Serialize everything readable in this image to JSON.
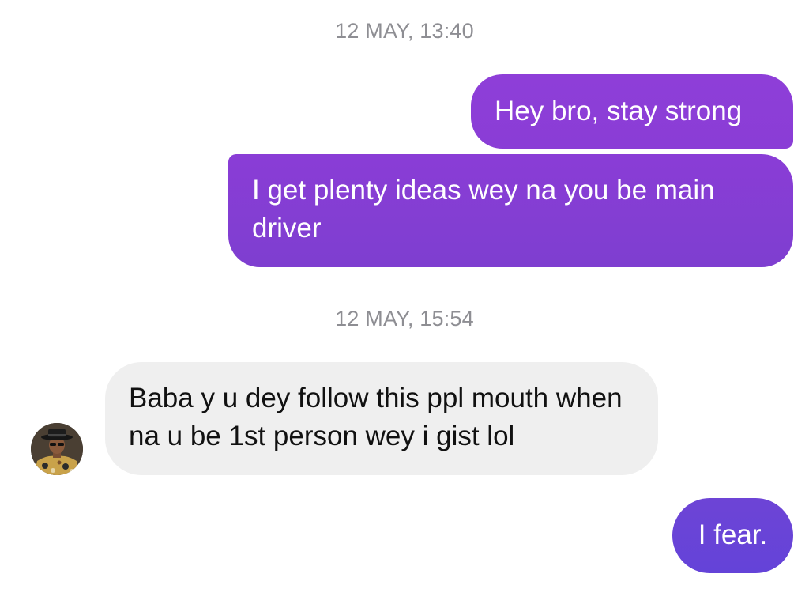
{
  "conversation": {
    "timestamps": [
      "12 MAY, 13:40",
      "12 MAY, 15:54"
    ],
    "messages": [
      {
        "direction": "outgoing",
        "text": "Hey bro, stay strong"
      },
      {
        "direction": "outgoing",
        "text": "I get plenty ideas wey na you be main driver"
      },
      {
        "direction": "incoming",
        "text": "Baba y u dey follow this ppl mouth when na u be 1st person wey i gist lol"
      },
      {
        "direction": "outgoing",
        "text": "I fear."
      }
    ]
  },
  "contact": {
    "avatar_icon": "contact-avatar"
  },
  "colors": {
    "outgoing_bubble": "#8a3dd6",
    "outgoing_bubble_last": "#6843d7",
    "incoming_bubble": "#efefef",
    "timestamp_text": "#8e8e93"
  }
}
